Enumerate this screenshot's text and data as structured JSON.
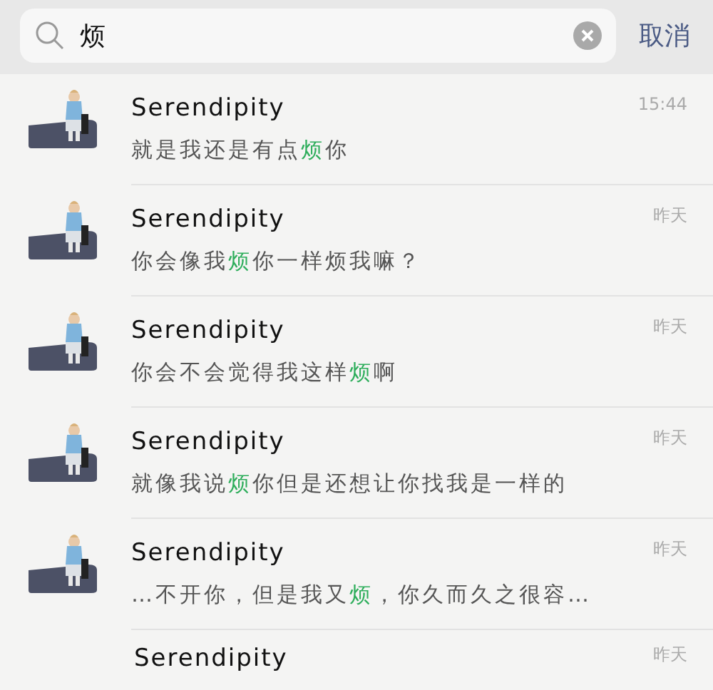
{
  "search": {
    "value": "烦",
    "cancel": "取消"
  },
  "results": [
    {
      "name": "Serendipity",
      "time": "15:44",
      "before": "就是我还是有点",
      "match": "烦",
      "after": "你"
    },
    {
      "name": "Serendipity",
      "time": "昨天",
      "before": "你会像我",
      "match": "烦",
      "after": "你一样烦我嘛？"
    },
    {
      "name": "Serendipity",
      "time": "昨天",
      "before": "你会不会觉得我这样",
      "match": "烦",
      "after": "啊"
    },
    {
      "name": "Serendipity",
      "time": "昨天",
      "before": "就像我说",
      "match": "烦",
      "after": "你但是还想让你找我是一样的"
    },
    {
      "name": "Serendipity",
      "time": "昨天",
      "before": "…不开你，但是我又",
      "match": "烦",
      "after": "，你久而久之很容…"
    },
    {
      "name": "Serendipity",
      "time": "昨天"
    }
  ]
}
